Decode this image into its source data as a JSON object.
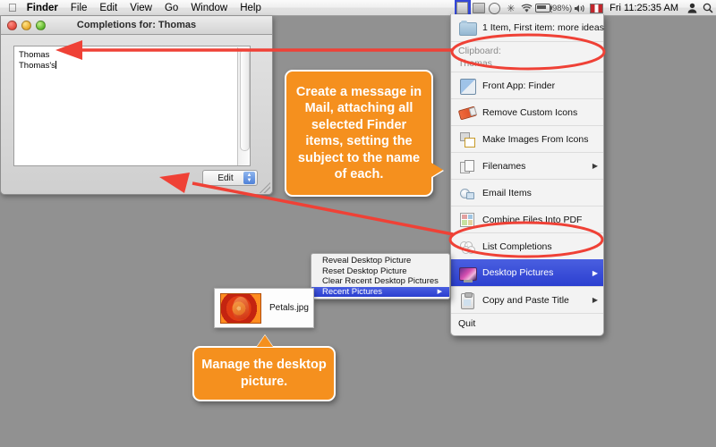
{
  "menubar": {
    "apple_icon": "apple-logo-icon",
    "items": [
      {
        "label": "Finder",
        "bold": true
      },
      {
        "label": "File",
        "bold": false
      },
      {
        "label": "Edit",
        "bold": false
      },
      {
        "label": "View",
        "bold": false
      },
      {
        "label": "Go",
        "bold": false
      },
      {
        "label": "Window",
        "bold": false
      },
      {
        "label": "Help",
        "bold": false
      }
    ],
    "status": {
      "script_menu_icon": "script-menu-icon",
      "gear_icon": "gear-icon",
      "timemachine_icon": "time-machine-icon",
      "bluetooth_icon": "bluetooth-icon",
      "bluetooth_glyph": "✳",
      "wifi_icon": "wifi-icon",
      "wifi_glyph": "◗",
      "battery_icon": "battery-icon",
      "battery_percent": "(98%)",
      "volume_icon": "volume-icon",
      "volume_glyph": "◀)",
      "flag_icon": "input-flag-icon",
      "clock": "Fri 11:25:35 AM",
      "user_icon": "user-account-icon",
      "user_glyph": "👤",
      "search_icon": "spotlight-search-icon",
      "search_glyph": "🔍"
    }
  },
  "finder_window": {
    "title": "Completions for: Thomas",
    "close_button": "close",
    "minimize_button": "minimize",
    "zoom_button": "zoom",
    "text_lines": [
      "Thomas",
      "Thomas's"
    ],
    "popup_button": {
      "label": "Edit",
      "arrows_glyph": "▲▼"
    }
  },
  "dropdown": {
    "items": [
      {
        "label": "1 Item, First item: more ideas",
        "icon": "folder-icon",
        "submenu": false,
        "selected": false,
        "type": "info"
      },
      {
        "label": "Clipboard:",
        "sublabel": "Thomas",
        "icon": "none",
        "submenu": false,
        "selected": false,
        "type": "clipboard"
      },
      {
        "label": "Front App: Finder",
        "icon": "finder-icon",
        "submenu": false,
        "selected": false,
        "type": "normal"
      },
      {
        "label": "Remove Custom Icons",
        "icon": "eraser-icon",
        "submenu": false,
        "selected": false,
        "type": "normal"
      },
      {
        "label": "Make Images From Icons",
        "icon": "make-images-icon",
        "submenu": false,
        "selected": false,
        "type": "normal"
      },
      {
        "label": "Filenames",
        "icon": "filenames-icon",
        "submenu": true,
        "selected": false,
        "type": "normal"
      },
      {
        "label": "Email Items",
        "icon": "email-icon",
        "submenu": false,
        "selected": false,
        "type": "normal"
      },
      {
        "label": "Combine Files Into PDF",
        "icon": "pdf-icon",
        "submenu": false,
        "selected": false,
        "type": "normal"
      },
      {
        "label": "List Completions",
        "icon": "list-completions-icon",
        "submenu": false,
        "selected": false,
        "type": "normal"
      },
      {
        "label": "Desktop Pictures",
        "icon": "desktop-pictures-icon",
        "submenu": true,
        "selected": true,
        "type": "normal"
      },
      {
        "label": "Copy and Paste Title",
        "icon": "clipboard-icon",
        "submenu": true,
        "selected": false,
        "type": "normal"
      },
      {
        "label": "Quit",
        "icon": "none",
        "submenu": false,
        "selected": false,
        "type": "quit"
      }
    ],
    "submenu_arrow_glyph": "▶"
  },
  "submenu": {
    "items": [
      {
        "label": "Reveal Desktop Picture",
        "selected": false,
        "submenu": false
      },
      {
        "label": "Reset Desktop Picture",
        "selected": false,
        "submenu": false
      },
      {
        "label": "Clear Recent Desktop Pictures",
        "selected": false,
        "submenu": false
      },
      {
        "label": "Recent Pictures",
        "selected": true,
        "submenu": true
      }
    ],
    "arrow_glyph": "▶"
  },
  "picture_popup": {
    "filename": "Petals.jpg",
    "thumbnail": "petals-thumbnail"
  },
  "callouts": [
    {
      "id": "mail",
      "text": "Create a message in Mail, attaching all selected Finder items, setting the subject to the name of each."
    },
    {
      "id": "desktop",
      "text": "Manage the desktop picture."
    }
  ],
  "colors": {
    "desktop_background": "#919191",
    "callout_orange": "#f5901e",
    "annotation_red": "#ef4136",
    "menu_highlight_blue": "#3448d8"
  }
}
